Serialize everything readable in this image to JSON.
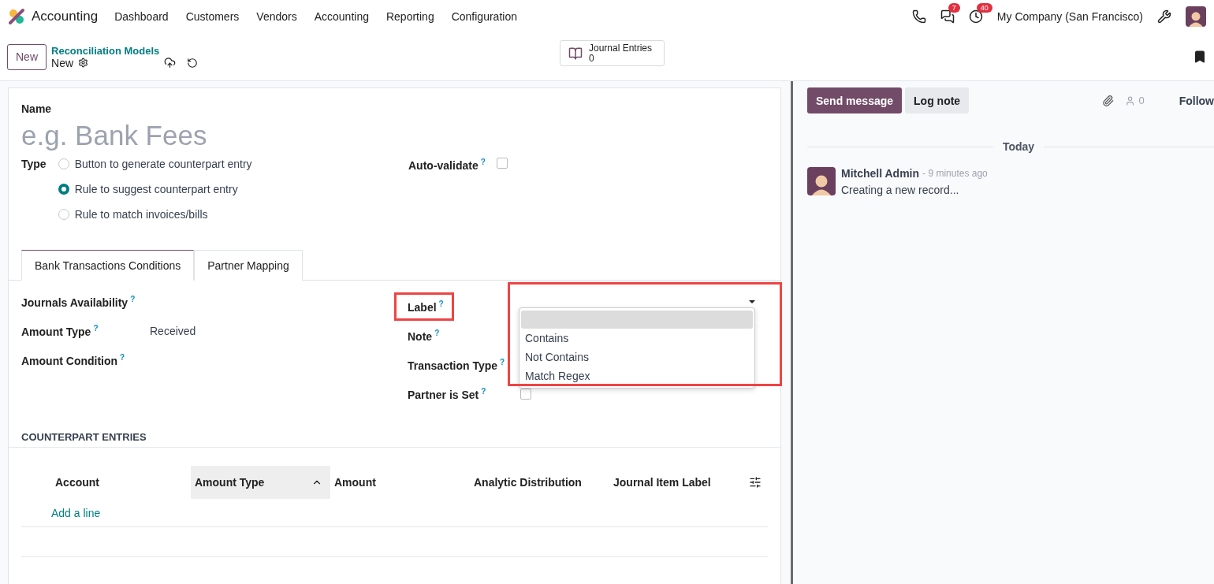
{
  "navbar": {
    "app_name": "Accounting",
    "menu": [
      "Dashboard",
      "Customers",
      "Vendors",
      "Accounting",
      "Reporting",
      "Configuration"
    ],
    "message_count": "7",
    "activity_count": "40",
    "company": "My Company (San Francisco)"
  },
  "control_panel": {
    "new_button": "New",
    "breadcrumb": "Reconciliation Models",
    "record_title": "New",
    "smart_button": {
      "label": "Journal Entries",
      "count": "0"
    }
  },
  "form": {
    "name_label": "Name",
    "name_placeholder": "e.g. Bank Fees",
    "type_label": "Type",
    "type_options": [
      {
        "label": "Button to generate counterpart entry",
        "selected": false
      },
      {
        "label": "Rule to suggest counterpart entry",
        "selected": true
      },
      {
        "label": "Rule to match invoices/bills",
        "selected": false
      }
    ],
    "auto_validate": {
      "label": "Auto-validate",
      "hint": "?",
      "checked": false
    },
    "tabs": [
      {
        "label": "Bank Transactions Conditions",
        "selected": true
      },
      {
        "label": "Partner Mapping",
        "selected": false
      }
    ],
    "left_fields": [
      {
        "label": "Journals Availability",
        "hint": "?"
      },
      {
        "label": "Amount Type",
        "hint": "?",
        "value": "Received"
      },
      {
        "label": "Amount Condition",
        "hint": "?"
      }
    ],
    "right_fields": [
      {
        "label": "Label",
        "hint": "?",
        "kind": "select",
        "highlighted": true
      },
      {
        "label": "Note",
        "hint": "?",
        "kind": "select",
        "highlighted": false
      },
      {
        "label": "Transaction Type",
        "hint": "?",
        "kind": "select",
        "highlighted": false
      },
      {
        "label": "Partner is Set",
        "hint": "?",
        "kind": "checkbox",
        "checked": false,
        "highlighted": false
      }
    ],
    "label_dropdown": {
      "open": true,
      "options": [
        "Contains",
        "Not Contains",
        "Match Regex"
      ]
    },
    "counterpart": {
      "title": "COUNTERPART ENTRIES",
      "columns": [
        {
          "label": "Account",
          "sorted": false
        },
        {
          "label": "Amount Type",
          "sorted": true
        },
        {
          "label": "Amount",
          "sorted": false
        },
        {
          "label": "Analytic Distribution",
          "sorted": false
        },
        {
          "label": "Journal Item Label",
          "sorted": false
        }
      ],
      "add_line": "Add a line"
    }
  },
  "chatter": {
    "send_message": "Send message",
    "log_note": "Log note",
    "follower_count": "0",
    "follow": "Follow",
    "date_separator": "Today",
    "messages": [
      {
        "author": "Mitchell Admin",
        "time": "- 9 minutes ago",
        "body": "Creating a new record..."
      }
    ]
  }
}
